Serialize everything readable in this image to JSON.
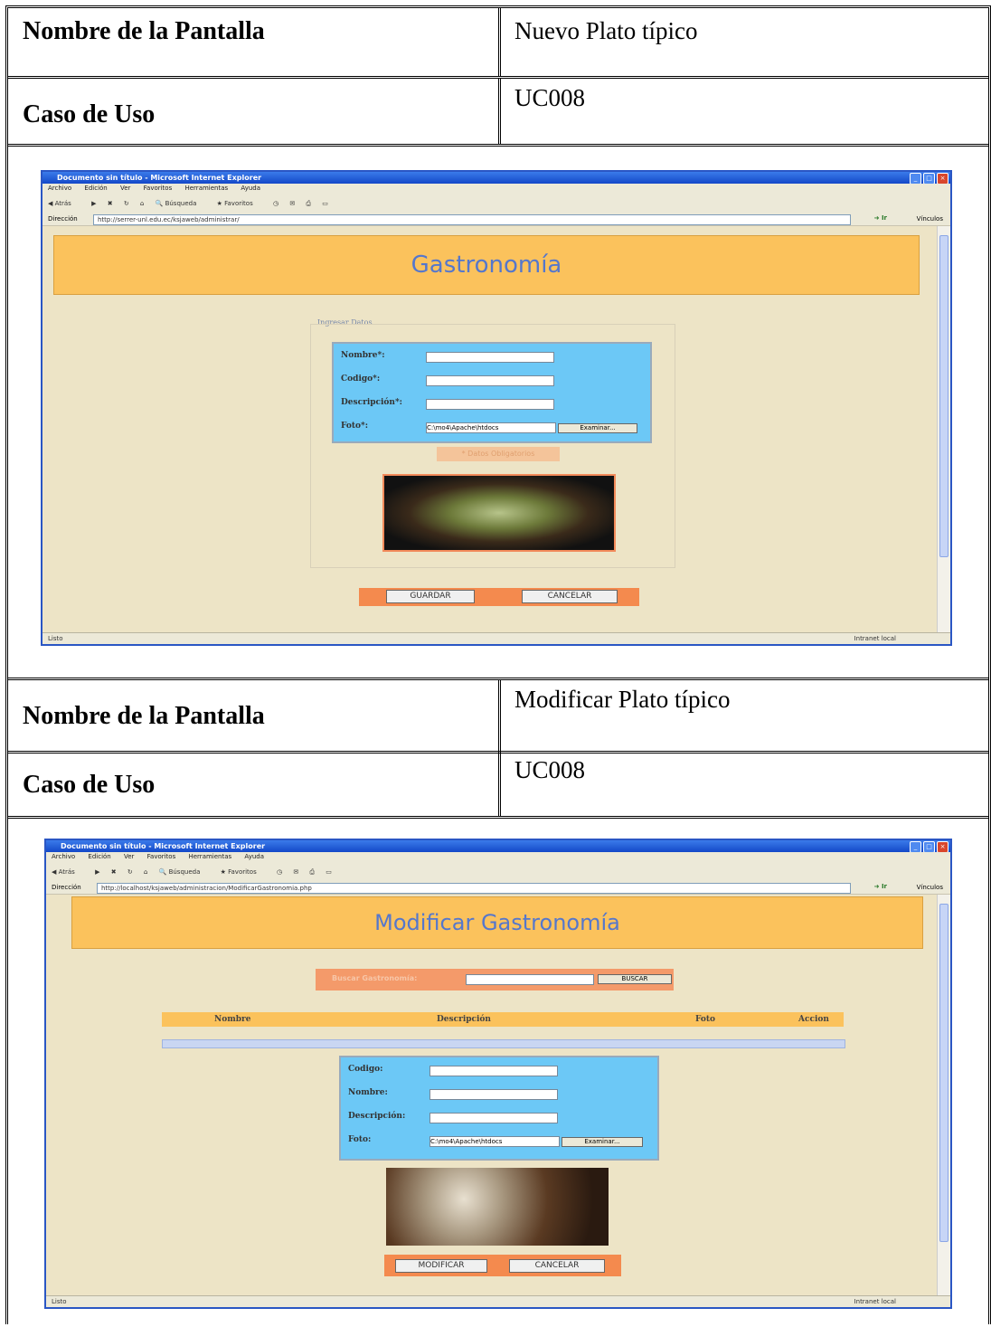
{
  "screen1": {
    "label_name": "Nombre de la Pantalla",
    "value_name": "Nuevo Plato típico",
    "label_case": "Caso de Uso",
    "value_case": "UC008",
    "window": {
      "title": "Documento sin título - Microsoft Internet Explorer",
      "menus": [
        "Archivo",
        "Edición",
        "Ver",
        "Favoritos",
        "Herramientas",
        "Ayuda"
      ],
      "toolbar": [
        "Atrás",
        "Búsqueda",
        "Favoritos"
      ],
      "address_label": "Dirección",
      "address": "http://serrer-unl.edu.ec/ksjaweb/administrar/",
      "go": "Ir",
      "links": "Vínculos",
      "status_left": "Listo",
      "status_right": "Intranet local"
    },
    "banner": "Gastronomía",
    "legend": "Ingresar Datos",
    "fields": [
      {
        "label": "Nombre*:",
        "value": ""
      },
      {
        "label": "Codigo*:",
        "value": ""
      },
      {
        "label": "Descripción*:",
        "value": ""
      },
      {
        "label": "Foto*:",
        "value": "C:\\mo4\\Apache\\htdocs"
      }
    ],
    "browse_button": "Examinar...",
    "note": "* Datos Obligatorios",
    "save_button": "GUARDAR",
    "cancel_button": "CANCELAR"
  },
  "screen2": {
    "label_name": "Nombre de la Pantalla",
    "value_name": "Modificar Plato típico",
    "label_case": "Caso de Uso",
    "value_case": "UC008",
    "window": {
      "title": "Documento sin título - Microsoft Internet Explorer",
      "menus": [
        "Archivo",
        "Edición",
        "Ver",
        "Favoritos",
        "Herramientas",
        "Ayuda"
      ],
      "toolbar": [
        "Atrás",
        "Búsqueda",
        "Favoritos"
      ],
      "address_label": "Dirección",
      "address": "http://localhost/ksjaweb/administracion/ModificarGastronomia.php",
      "go": "Ir",
      "links": "Vínculos",
      "status_left": "Listo",
      "status_right": "Intranet local"
    },
    "banner": "Modificar Gastronomía",
    "search_label": "Buscar Gastronomía:",
    "search_button": "BUSCAR",
    "table_headers": [
      "Nombre",
      "Descripción",
      "Foto",
      "Accion"
    ],
    "fields": [
      {
        "label": "Codigo:",
        "value": ""
      },
      {
        "label": "Nombre:",
        "value": ""
      },
      {
        "label": "Descripción:",
        "value": ""
      },
      {
        "label": "Foto:",
        "value": "C:\\mo4\\Apache\\htdocs"
      }
    ],
    "browse_button": "Examinar...",
    "modify_button": "MODIFICAR",
    "cancel_button": "CANCELAR"
  }
}
